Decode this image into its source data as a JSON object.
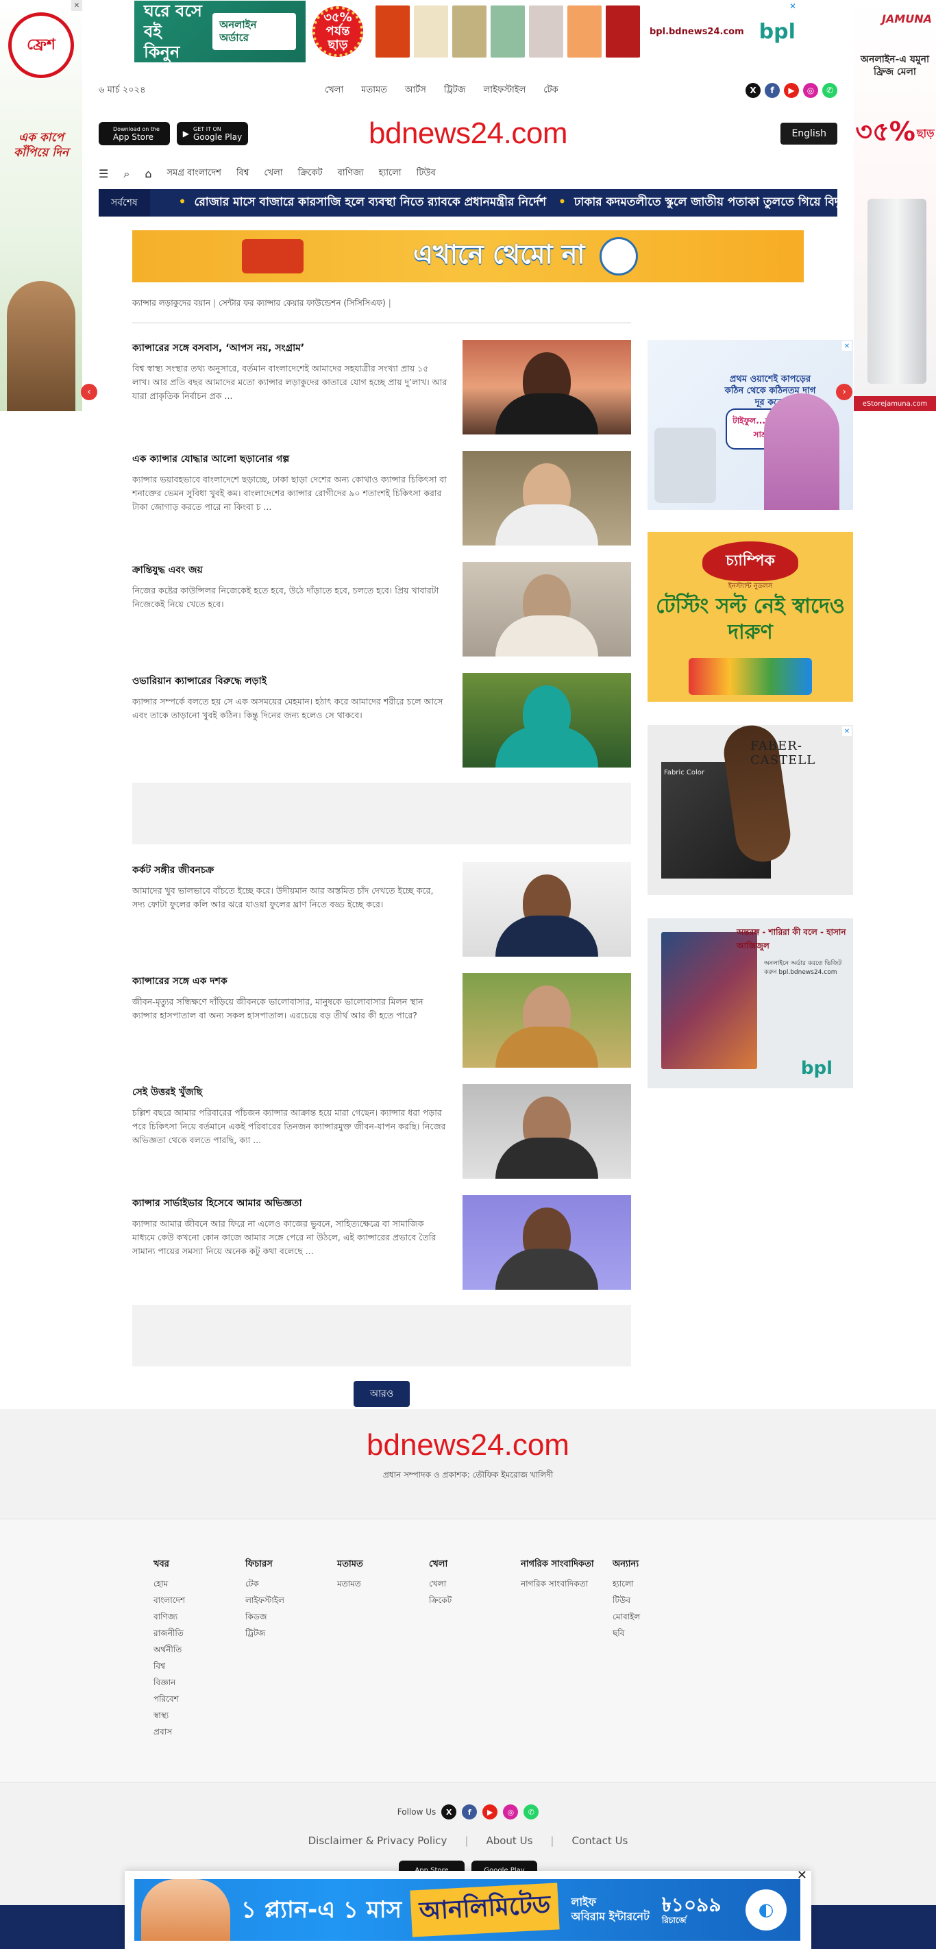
{
  "side_ads": {
    "left": {
      "brand": "ফ্রেশ",
      "slogan": "এক কাপে কাঁপিয়ে দিন"
    },
    "right": {
      "brand": "JAMUNA",
      "headline": "অনলাইন-এ যমুনা ফ্রিজ মেলা",
      "discount": "৩৫%",
      "discount_word": "ছাড়",
      "url": "eStorejamuna.com"
    }
  },
  "top_banner": {
    "line1": "ঘরে বসে",
    "line2": "বই কিনুন",
    "online": "অনলাইন অর্ডারে",
    "discount": "৩৫% পর্যন্ত ছাড়",
    "url": "bpl.bdnews24.com",
    "brand": "bpl"
  },
  "header": {
    "date": "৬ মার্চ ২০২৪",
    "top_nav": [
      "খেলা",
      "মতামত",
      "আর্টস",
      "ট্রিটজ",
      "লাইফস্টাইল",
      "টেক"
    ],
    "logo": "bdnews24.com",
    "english_button": "English",
    "app_store": {
      "small": "Download on the",
      "big": "App Store"
    },
    "google_play": {
      "small": "GET IT ON",
      "big": "Google Play"
    }
  },
  "main_nav": [
    "সমগ্র বাংলাদেশ",
    "বিশ্ব",
    "খেলা",
    "ক্রিকেট",
    "বাণিজ্য",
    "হ্যালো",
    "টিউব"
  ],
  "ticker": {
    "label": "সর্বশেষ",
    "items": [
      "রোজার মাসে বাজারে কারসাজি হলে ব্যবস্থা নিতে র‌্যাবকে প্রধানমন্ত্রীর নির্দেশ",
      "ঢাকার কদমতলীতে স্কুলে জাতীয় পতাকা তুলতে গিয়ে বিদ্যুতায়িত হয়ে"
    ]
  },
  "banner_ad": {
    "text": "এখানে থেমো না"
  },
  "breadcrumb": [
    "ক্যান্সার লড়াকুদের বয়ান",
    "সেন্টার ফর ক্যান্সার কেয়ার ফাউন্ডেশন (সিসিসিএফ)"
  ],
  "articles": [
    {
      "title": "ক্যান্সারের সঙ্গে বসবাস, ‘আপস নয়, সংগ্রাম’",
      "summary": "বিশ্ব স্বাস্থ্য সংস্থার তথ্য অনুসারে, বর্তমান বাংলাদেশেই আমাদের সহযাত্রীর সংখ্যা প্রায় ১৫ লাখ। আর প্রতি বছর আমাদের মতো ক্যান্সার লড়াকুদের কাতারে যোগ হচ্ছে প্রায় দু’লাখ। আর যারা প্রাকৃতিক নির্বাচন প্রক ..."
    },
    {
      "title": "এক ক্যান্সার যোদ্ধার আলো ছড়ানোর গল্প",
      "summary": "ক্যান্সার ভয়াবহভাবে বাংলাদেশে ছড়াচ্ছে, ঢাকা ছাড়া দেশের অন্য কোথাও ক্যান্সার চিকিৎসা বা শনাক্তের ভেমন সুবিধা খুবই কম। বাংলাদেশের ক্যান্সার রোগীদের ৯০ শতাংশই চিকিৎসা করার টাকা জোগাড় করতে পারে না কিংবা চ ..."
    },
    {
      "title": "ক্রান্তিযুদ্ধ এবং জয়",
      "summary": "নিজের কষ্টের কাউন্সিলর নিজেকেই হতে হবে, উঠে দাঁড়াতে হবে, চলতে হবে। প্রিয় খাবারটা নিজেকেই নিয়ে খেতে হবে।"
    },
    {
      "title": "ওভারিয়ান ক্যান্সারের বিরুদ্ধে লড়াই",
      "summary": "ক্যান্সার সম্পর্কে বলতে হয় সে এক অসময়ের মেহমান। হঠাৎ করে আমাদের শরীরে চলে আসে এবং তাকে তাড়ানো খুবই কঠিন। কিন্তু দিনের জন্য হলেও সে থাকবে।"
    },
    {
      "title": "কর্কট সঙ্গীর জীবনচক্র",
      "summary": "আমাদের খুব ভালভাবে বাঁচতে ইচ্ছে করে। উদীয়মান আর অস্তমিত চাঁদ দেখতে ইচ্ছে করে, সদ্য ফোটা ফুলের কলি আর ঝরে যাওয়া ফুলের ঘ্রাণ নিতে বড্ড ইচ্ছে করে।"
    },
    {
      "title": "ক্যান্সারের সঙ্গে এক দশক",
      "summary": "জীবন-মৃত্যুর সন্ধিক্ষণে দাঁড়িয়ে জীবনকে ভালোবাসার, মানুষকে ভালোবাসার মিলন স্থান ক্যান্সার হাসপাতাল বা অন্য সকল হাসপাতাল। এরচেয়ে বড় তীর্থ আর কী হতে পারে?"
    },
    {
      "title": "সেই উত্তরই খুঁজছি",
      "summary": "চল্লিশ বছরে আমার পরিবারের পাঁচজন ক্যান্সার আক্রান্ত হয়ে মারা গেছেন। ক্যান্সার ধরা পড়ার পরে চিকিৎসা নিয়ে বর্তমানে একই পরিবারের তিনজন ক্যান্সারমুক্ত জীবন-যাপন করছি। নিজের অভিজ্ঞতা থেকে বলতে পারছি, ক্যা ..."
    },
    {
      "title": "ক্যান্সার সার্ভাইভার হিসেবে আমার অভিজ্ঞতা",
      "summary": "ক্যান্সার আমার জীবনে আর ফিরে না এলেও কাজের ভুবনে, সাহিত্যক্ষেত্রে বা সামাজিক মাধ্যমে কেউ কখনো কোন কাজে আমার সঙ্গে পেরে না উঠলে, এই ক্যান্সারের প্রভাবে তৈরি সামান্য পায়ের সমস্যা নিয়ে অনেক কটু কথা বলেছে ..."
    }
  ],
  "right_ads": {
    "ad1": {
      "title": "প্রথম ওয়াশেই কাপড়ের কঠিন থেকে কঠিনতম দাগ দূর করে।",
      "bubble": "টাইফুল...লাগে কম, তাই সাশ্রয় বেশি!"
    },
    "ad2": {
      "brand": "চ্যাম্পিক",
      "sub": "ইনস্ট্যান্ট নুডলস",
      "text": "টেস্টিং সল্ট নেই স্বাদেও দারুণ"
    },
    "ad3": {
      "brand": "FABER-CASTELL",
      "label": "Fabric Color"
    },
    "ad4": {
      "title": "অন্তরঙ্গ - শারিরা কী বলে - হাসান আজিজুল",
      "desc": "অনলাইনে অর্ডার করতে ভিজিট করুন bpl.bdnews24.com",
      "brand": "bpl"
    }
  },
  "more_button": "আরও",
  "footer": {
    "logo": "bdnews24.com",
    "editor": "প্রধান সম্পাদক ও প্রকাশক: তৌফিক ইমরোজ খালিদী",
    "columns": [
      {
        "title": "খবর",
        "links": [
          "হোম",
          "বাংলাদেশ",
          "বাণিজ্য",
          "রাজনীতি",
          "অর্থনীতি",
          "বিশ্ব",
          "বিজ্ঞান",
          "পরিবেশ",
          "স্বাস্থ্য",
          "প্রবাস"
        ]
      },
      {
        "title": "ফিচারস",
        "links": [
          "টেক",
          "লাইফস্টাইল",
          "কিডজ",
          "ট্রিটজ"
        ]
      },
      {
        "title": "মতামত",
        "links": [
          "মতামত"
        ]
      },
      {
        "title": "খেলা",
        "links": [
          "খেলা",
          "ক্রিকেট"
        ]
      },
      {
        "title": "নাগরিক সাংবাদিকতা",
        "links": [
          "নাগরিক সাংবাদিকতা"
        ]
      },
      {
        "title": "অন্যান্য",
        "links": [
          "হ্যালো",
          "টিউব",
          "মোবাইল",
          "ছবি"
        ]
      }
    ],
    "follow_label": "Follow Us",
    "legal": [
      "Disclaimer & Privacy Policy",
      "About Us",
      "Contact Us"
    ]
  },
  "sticky_ad": {
    "plan": "১ প্ল্যান-এ ১ মাস",
    "unlimited": "আনলিমিটেড",
    "line1": "লাইফ",
    "line2": "অবিরাম ইন্টারনেট",
    "price": "৳১০৯৯",
    "price_sub": "রিচার্জে"
  },
  "colors": {
    "brand_red": "#e0191f",
    "navy": "#152a60"
  }
}
